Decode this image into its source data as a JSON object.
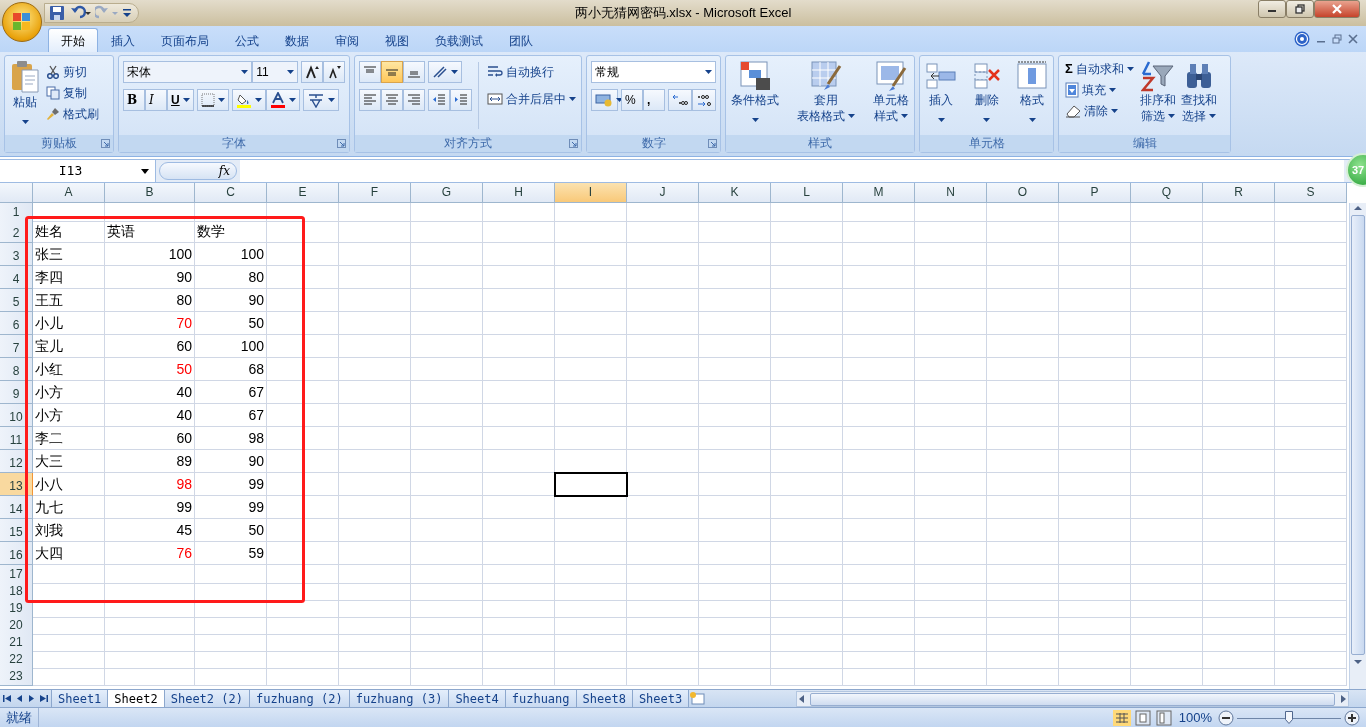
{
  "window": {
    "title": "两小无猜网密码.xlsx - Microsoft Excel"
  },
  "tabs": [
    {
      "label": "开始",
      "selected": true
    },
    {
      "label": "插入",
      "selected": false
    },
    {
      "label": "页面布局",
      "selected": false
    },
    {
      "label": "公式",
      "selected": false
    },
    {
      "label": "数据",
      "selected": false
    },
    {
      "label": "审阅",
      "selected": false
    },
    {
      "label": "视图",
      "selected": false
    },
    {
      "label": "负载测试",
      "selected": false
    },
    {
      "label": "团队",
      "selected": false
    }
  ],
  "ribbon": {
    "clipboard": {
      "title": "剪贴板",
      "paste": "粘贴",
      "commands": [
        "剪切",
        "复制",
        "格式刷"
      ]
    },
    "font": {
      "title": "字体",
      "font_name": "宋体",
      "font_size": "11",
      "bold": "B",
      "italic": "I",
      "underline": "U"
    },
    "alignment": {
      "title": "对齐方式",
      "vertical_align": [
        {
          "selected": false
        },
        {
          "selected": true
        },
        {
          "selected": false
        }
      ],
      "wrap_text": "自动换行",
      "merge": "合并后居中"
    },
    "number": {
      "title": "数字",
      "format": "常规",
      "percent": "%",
      "comma": ","
    },
    "styles": {
      "title": "样式",
      "commands": [
        {
          "lines": [
            "条件格式"
          ]
        },
        {
          "lines": [
            "套用",
            "表格格式"
          ]
        },
        {
          "lines": [
            "单元格",
            "样式"
          ]
        }
      ]
    },
    "cells": {
      "title": "单元格",
      "commands": [
        {
          "lines": [
            "插入"
          ]
        },
        {
          "lines": [
            "删除"
          ]
        },
        {
          "lines": [
            "格式"
          ]
        }
      ]
    },
    "editing": {
      "title": "编辑",
      "sum_symbol": "Σ",
      "small_commands": [
        "自动求和",
        "填充",
        "清除"
      ],
      "commands": [
        {
          "lines": [
            "排序和",
            "筛选"
          ]
        },
        {
          "lines": [
            "查找和",
            "选择"
          ]
        }
      ]
    }
  },
  "formula_bar": {
    "name_box": "I13",
    "function_label": "fx"
  },
  "columns": [
    {
      "label": "A",
      "selected": false
    },
    {
      "label": "B",
      "selected": false
    },
    {
      "label": "C",
      "selected": false
    },
    {
      "label": "E",
      "selected": false
    },
    {
      "label": "F",
      "selected": false
    },
    {
      "label": "G",
      "selected": false
    },
    {
      "label": "H",
      "selected": false
    },
    {
      "label": "I",
      "selected": true
    },
    {
      "label": "J",
      "selected": false
    },
    {
      "label": "K",
      "selected": false
    },
    {
      "label": "L",
      "selected": false
    },
    {
      "label": "M",
      "selected": false
    },
    {
      "label": "N",
      "selected": false
    },
    {
      "label": "O",
      "selected": false
    },
    {
      "label": "P",
      "selected": false
    },
    {
      "label": "Q",
      "selected": false
    },
    {
      "label": "R",
      "selected": false
    },
    {
      "label": "S",
      "selected": false
    }
  ],
  "rows": [
    {
      "label": "1",
      "selected": false,
      "cells": []
    },
    {
      "label": "2",
      "selected": false,
      "cells": [
        {
          "text": "姓名",
          "kind": "text"
        },
        {
          "text": "英语",
          "kind": "text"
        },
        {
          "text": "数学",
          "kind": "text"
        }
      ]
    },
    {
      "label": "3",
      "selected": false,
      "cells": [
        {
          "text": "张三",
          "kind": "text"
        },
        {
          "text": "100",
          "kind": "number",
          "color": "#000000"
        },
        {
          "text": "100",
          "kind": "number",
          "color": "#000000"
        }
      ]
    },
    {
      "label": "4",
      "selected": false,
      "cells": [
        {
          "text": "李四",
          "kind": "text"
        },
        {
          "text": "90",
          "kind": "number",
          "color": "#000000"
        },
        {
          "text": "80",
          "kind": "number",
          "color": "#000000"
        }
      ]
    },
    {
      "label": "5",
      "selected": false,
      "cells": [
        {
          "text": "王五",
          "kind": "text"
        },
        {
          "text": "80",
          "kind": "number",
          "color": "#000000"
        },
        {
          "text": "90",
          "kind": "number",
          "color": "#000000"
        }
      ]
    },
    {
      "label": "6",
      "selected": false,
      "cells": [
        {
          "text": "小儿",
          "kind": "text"
        },
        {
          "text": "70",
          "kind": "number",
          "color": "#ff0000"
        },
        {
          "text": "50",
          "kind": "number",
          "color": "#000000"
        }
      ]
    },
    {
      "label": "7",
      "selected": false,
      "cells": [
        {
          "text": "宝儿",
          "kind": "text"
        },
        {
          "text": "60",
          "kind": "number",
          "color": "#000000"
        },
        {
          "text": "100",
          "kind": "number",
          "color": "#000000"
        }
      ]
    },
    {
      "label": "8",
      "selected": false,
      "cells": [
        {
          "text": "小红",
          "kind": "text"
        },
        {
          "text": "50",
          "kind": "number",
          "color": "#ff0000"
        },
        {
          "text": "68",
          "kind": "number",
          "color": "#000000"
        }
      ]
    },
    {
      "label": "9",
      "selected": false,
      "cells": [
        {
          "text": "小方",
          "kind": "text"
        },
        {
          "text": "40",
          "kind": "number",
          "color": "#000000"
        },
        {
          "text": "67",
          "kind": "number",
          "color": "#000000"
        }
      ]
    },
    {
      "label": "10",
      "selected": false,
      "cells": [
        {
          "text": "小方",
          "kind": "text"
        },
        {
          "text": "40",
          "kind": "number",
          "color": "#000000"
        },
        {
          "text": "67",
          "kind": "number",
          "color": "#000000"
        }
      ]
    },
    {
      "label": "11",
      "selected": false,
      "cells": [
        {
          "text": "李二",
          "kind": "text"
        },
        {
          "text": "60",
          "kind": "number",
          "color": "#000000"
        },
        {
          "text": "98",
          "kind": "number",
          "color": "#000000"
        }
      ]
    },
    {
      "label": "12",
      "selected": false,
      "cells": [
        {
          "text": "大三",
          "kind": "text"
        },
        {
          "text": "89",
          "kind": "number",
          "color": "#000000"
        },
        {
          "text": "90",
          "kind": "number",
          "color": "#000000"
        }
      ]
    },
    {
      "label": "13",
      "selected": true,
      "cells": [
        {
          "text": "小八",
          "kind": "text"
        },
        {
          "text": "98",
          "kind": "number",
          "color": "#ff0000"
        },
        {
          "text": "99",
          "kind": "number",
          "color": "#000000"
        }
      ]
    },
    {
      "label": "14",
      "selected": false,
      "cells": [
        {
          "text": "九七",
          "kind": "text"
        },
        {
          "text": "99",
          "kind": "number",
          "color": "#000000"
        },
        {
          "text": "99",
          "kind": "number",
          "color": "#000000"
        }
      ]
    },
    {
      "label": "15",
      "selected": false,
      "cells": [
        {
          "text": "刘我",
          "kind": "text"
        },
        {
          "text": "45",
          "kind": "number",
          "color": "#000000"
        },
        {
          "text": "50",
          "kind": "number",
          "color": "#000000"
        }
      ]
    },
    {
      "label": "16",
      "selected": false,
      "cells": [
        {
          "text": "大四",
          "kind": "text"
        },
        {
          "text": "76",
          "kind": "number",
          "color": "#ff0000"
        },
        {
          "text": "59",
          "kind": "number",
          "color": "#000000"
        }
      ]
    },
    {
      "label": "17",
      "selected": false,
      "cells": []
    },
    {
      "label": "18",
      "selected": false,
      "cells": []
    },
    {
      "label": "19",
      "selected": false,
      "cells": []
    },
    {
      "label": "20",
      "selected": false,
      "cells": []
    },
    {
      "label": "21",
      "selected": false,
      "cells": []
    },
    {
      "label": "22",
      "selected": false,
      "cells": []
    },
    {
      "label": "23",
      "selected": false,
      "cells": []
    }
  ],
  "sheet_tabs": [
    {
      "label": "Sheet1",
      "selected": false
    },
    {
      "label": "Sheet2",
      "selected": true
    },
    {
      "label": "Sheet2 (2)",
      "selected": false
    },
    {
      "label": "fuzhuang (2)",
      "selected": false
    },
    {
      "label": "fuzhuang (3)",
      "selected": false
    },
    {
      "label": "Sheet4",
      "selected": false
    },
    {
      "label": "fuzhuang",
      "selected": false
    },
    {
      "label": "Sheet8",
      "selected": false
    },
    {
      "label": "Sheet3",
      "selected": false
    }
  ],
  "status_bar": {
    "text": "就绪",
    "zoom": "100%",
    "zoom_slider": {
      "level": 0.5
    }
  },
  "floating_badge": "37"
}
